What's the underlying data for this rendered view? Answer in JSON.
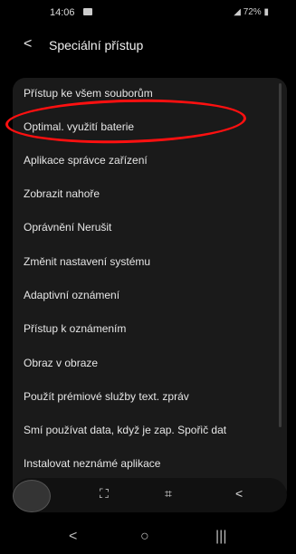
{
  "status_bar": {
    "time": "14:06",
    "battery": "72%"
  },
  "header": {
    "back_icon": "chevron-left-icon",
    "title": "Speciální přístup"
  },
  "menu_items": [
    "Přístup ke všem souborům",
    "Optimal. využití baterie",
    "Aplikace správce zařízení",
    "Zobrazit nahoře",
    "Oprávnění Nerušit",
    "Změnit nastavení systému",
    "Adaptivní oznámení",
    "Přístup k oznámením",
    "Obraz v obraze",
    "Použít prémiové služby text. zpráv",
    "Smí používat data, když je zap. Spořič dat",
    "Instalovat neznámé aplikace"
  ],
  "toolbar": {
    "icons": [
      "selection-circle-icon",
      "screenshot-icon",
      "crop-icon",
      "share-icon"
    ]
  },
  "navbar": {
    "icons": [
      "back-nav-icon",
      "home-nav-icon",
      "recents-nav-icon"
    ]
  },
  "colors": {
    "highlight": "#ff1010",
    "background": "#000000",
    "card": "#1a1a1a"
  }
}
